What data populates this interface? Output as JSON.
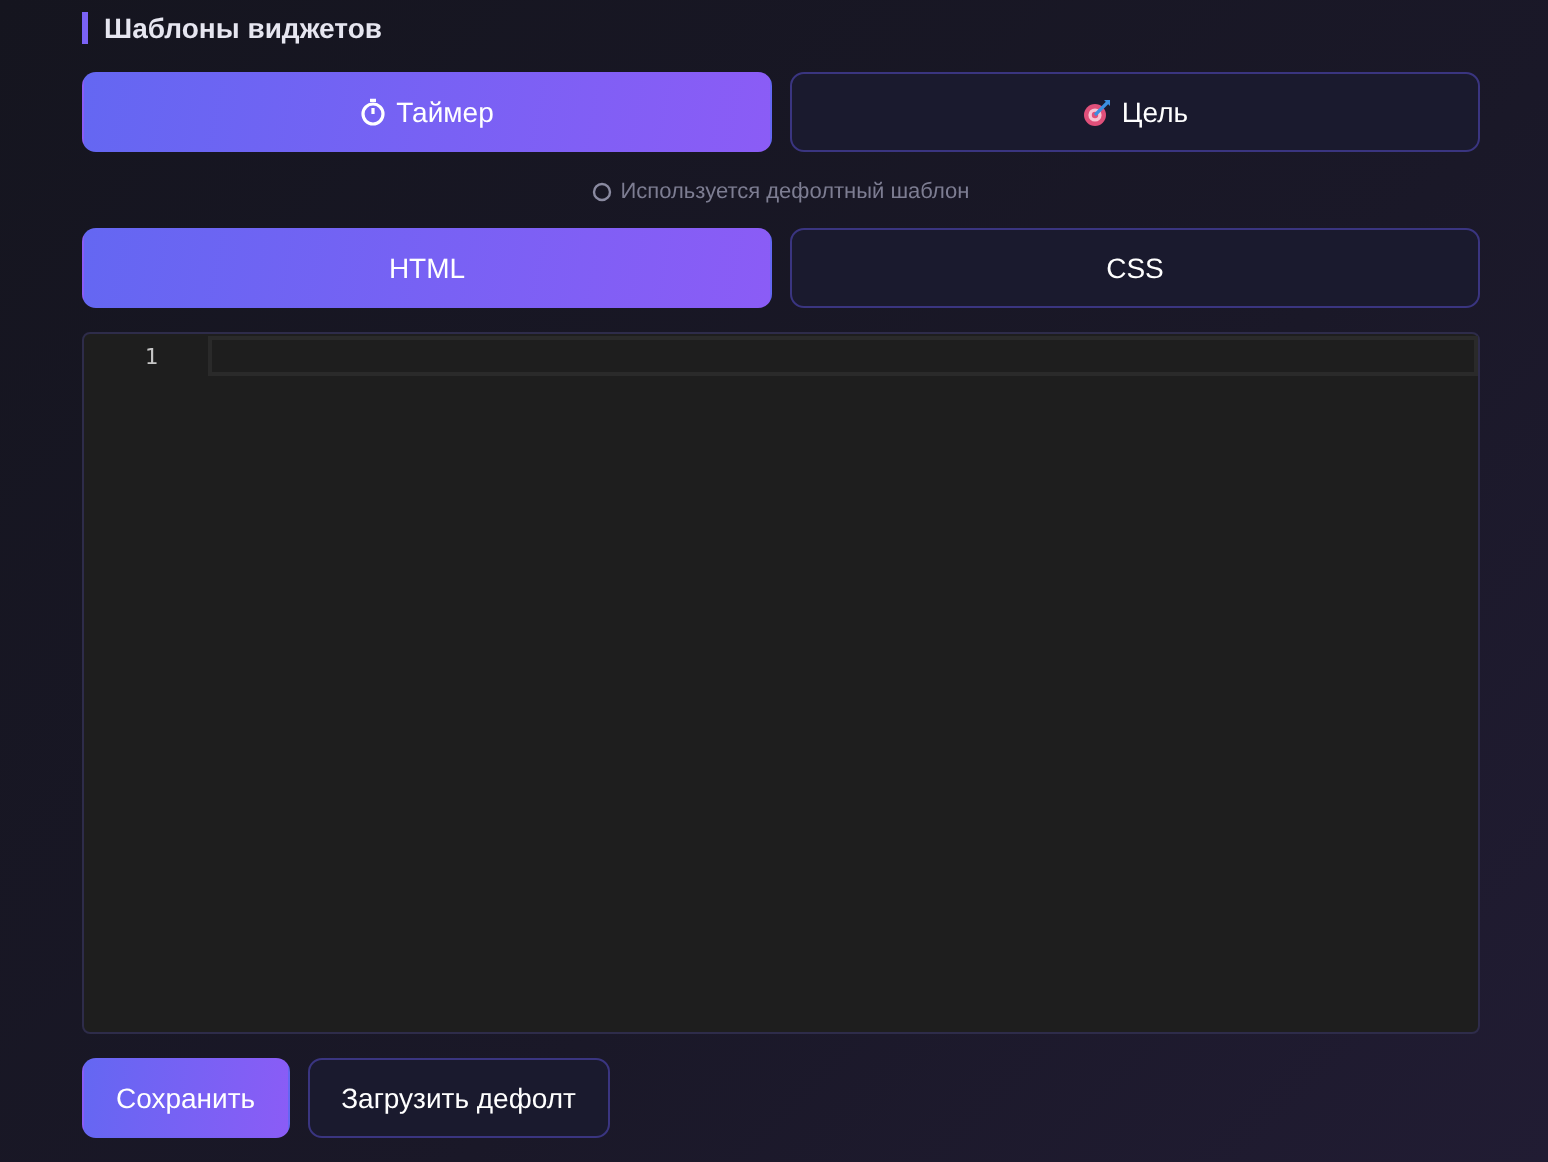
{
  "section_title": "Шаблоны виджетов",
  "widget_tabs": [
    {
      "label": "Таймер",
      "kind": "timer",
      "selected": true
    },
    {
      "label": "Цель",
      "kind": "target",
      "selected": false
    }
  ],
  "template_status": "Используется дефолтный шаблон",
  "code_tabs": [
    {
      "label": "HTML",
      "selected": true
    },
    {
      "label": "CSS",
      "selected": false
    }
  ],
  "editor": {
    "line_numbers": [
      "1"
    ]
  },
  "buttons": [
    {
      "label": "Сохранить",
      "kind": "primary"
    },
    {
      "label": "Загрузить дефолт",
      "kind": "secondary"
    }
  ]
}
